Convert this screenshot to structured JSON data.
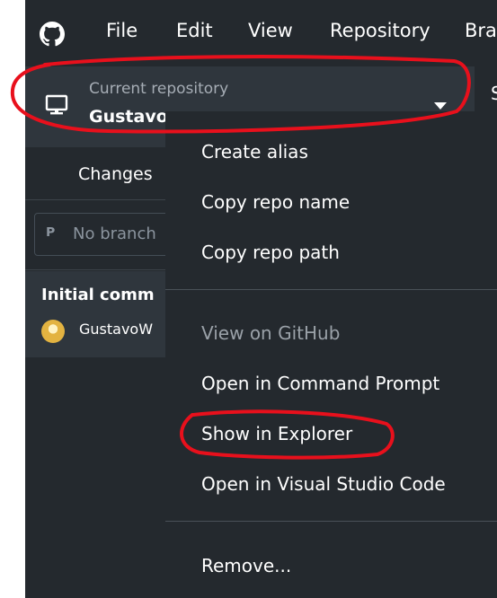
{
  "menubar": {
    "items": [
      {
        "label": "File"
      },
      {
        "label": "Edit"
      },
      {
        "label": "View"
      },
      {
        "label": "Repository"
      },
      {
        "label": "Bra"
      }
    ]
  },
  "repo_selector": {
    "caption": "Current repository",
    "name": "Gustavo"
  },
  "right_sliver_text": "S",
  "left_panel": {
    "changes_tab": "Changes",
    "branch_filter": "No branch",
    "commit": {
      "title": "Initial comm",
      "author": "GustavoW"
    }
  },
  "context_menu": {
    "items": [
      {
        "label": "Create alias"
      },
      {
        "label": "Copy repo name"
      },
      {
        "label": "Copy repo path"
      },
      {
        "label": "View on GitHub"
      },
      {
        "label": "Open in Command Prompt"
      },
      {
        "label": "Show in Explorer"
      },
      {
        "label": "Open in Visual Studio Code"
      },
      {
        "label": "Remove..."
      }
    ]
  },
  "colors": {
    "app_bg": "#24292e",
    "panel_bg": "#2f363d",
    "disabled_text": "#9aa1a8",
    "annotation": "#e8101c"
  },
  "icons": {
    "logo": "github-logo-icon",
    "repo": "computer-icon",
    "branch": "branch-icon",
    "dropdown": "caret-down-icon"
  }
}
